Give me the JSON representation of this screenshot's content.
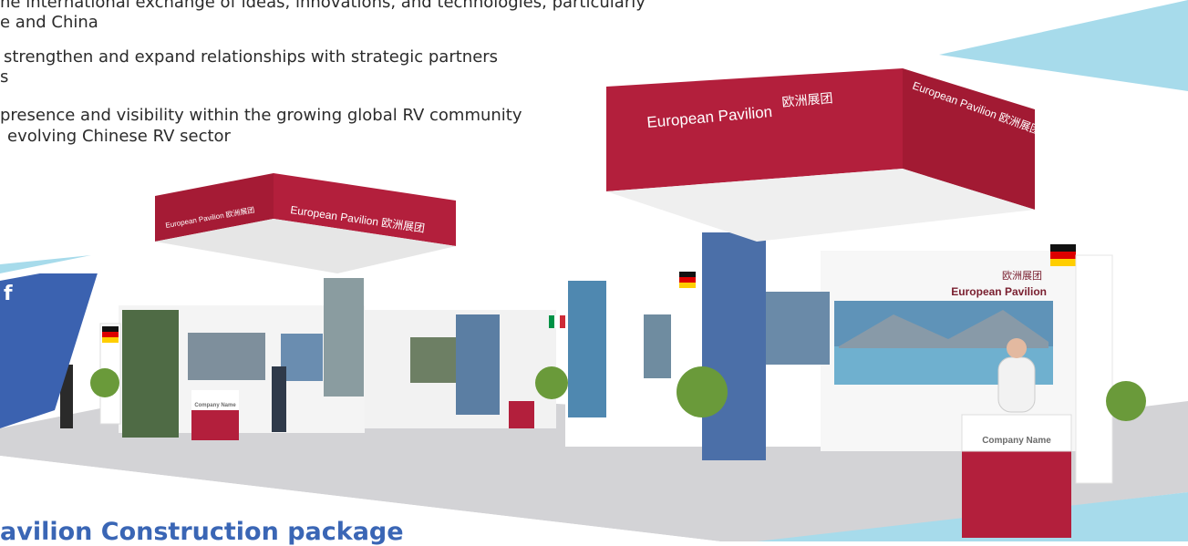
{
  "intro": {
    "bullets": [
      "he international exchange of ideas, innovations, and technologies, particularly",
      "e and China",
      "strengthen and expand relationships with strategic partners",
      "s",
      "presence and visibility within the growing global RV community",
      "evolving Chinese RV sector"
    ]
  },
  "callout": {
    "letter": "f"
  },
  "section": {
    "heading": "avilion Construction package"
  },
  "booth": {
    "main_sign_label": "European Pavilion",
    "main_sign_cn": "欧洲展团",
    "main_sign_side": "European Pavilion 欧洲展团",
    "left_sign_label": "European Pavilion 欧洲展团",
    "left_sign_side": "European Pavilion 欧洲展团",
    "wall_cn": "欧洲展团",
    "wall_label": "European Pavilion",
    "desk_company": "Company Name",
    "desk_company_left": "Company Name"
  },
  "colors": {
    "sign_red": "#b31f3c",
    "accent_blue": "#3a66b5",
    "light_blue": "#9fd6e8",
    "floor": "#cfcfd2"
  }
}
